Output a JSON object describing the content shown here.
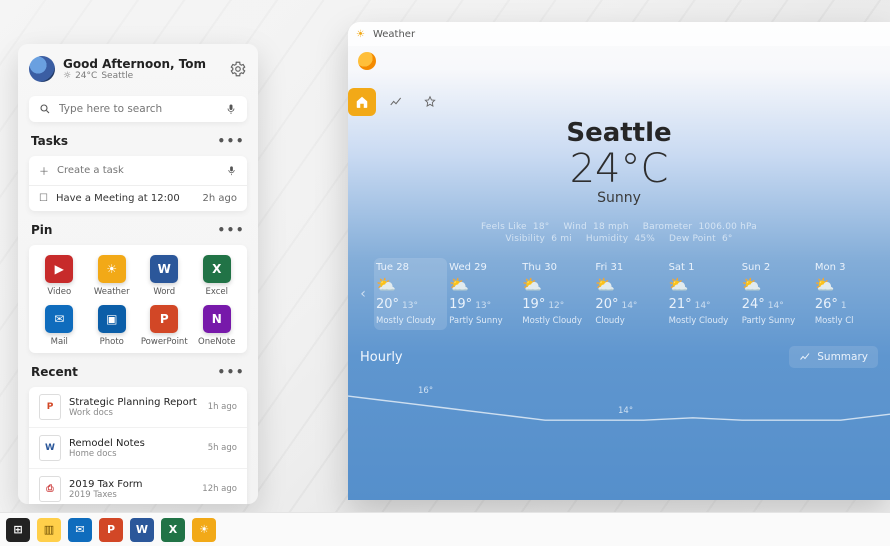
{
  "panel": {
    "greeting": "Good Afternoon, Tom",
    "sub_temp": "24°C",
    "sub_city": "Seattle",
    "search_placeholder": "Type here to search",
    "tasks_header": "Tasks",
    "task_create_placeholder": "Create a task",
    "task_item": "Have a Meeting at 12:00",
    "task_time": "2h ago",
    "pin_header": "Pin",
    "pins": [
      {
        "label": "Video",
        "bg": "#c72b2b",
        "letter": "▶"
      },
      {
        "label": "Weather",
        "bg": "#f2a917",
        "letter": "☀"
      },
      {
        "label": "Word",
        "bg": "#2b579a",
        "letter": "W"
      },
      {
        "label": "Excel",
        "bg": "#217346",
        "letter": "X"
      },
      {
        "label": "Mail",
        "bg": "#0f6cbd",
        "letter": "✉"
      },
      {
        "label": "Photo",
        "bg": "#0b5ea8",
        "letter": "▣"
      },
      {
        "label": "PowerPoint",
        "bg": "#d24726",
        "letter": "P"
      },
      {
        "label": "OneNote",
        "bg": "#7719aa",
        "letter": "N"
      }
    ],
    "recent_header": "Recent",
    "docs": [
      {
        "title": "Strategic Planning Report",
        "sub": "Work docs",
        "time": "1h ago",
        "badge": "P",
        "color": "#d24726"
      },
      {
        "title": "Remodel Notes",
        "sub": "Home docs",
        "time": "5h ago",
        "badge": "W",
        "color": "#2b579a"
      },
      {
        "title": "2019 Tax Form",
        "sub": "2019 Taxes",
        "time": "12h ago",
        "badge": "⎙",
        "color": "#cc3b3b"
      }
    ]
  },
  "weather": {
    "app_title": "Weather",
    "city": "Seattle",
    "temp": "24°C",
    "condition": "Sunny",
    "stats": {
      "feels_label": "Feels Like",
      "feels": "18°",
      "wind_label": "Wind",
      "wind": "18 mph",
      "baro_label": "Barometer",
      "baro": "1006.00 hPa",
      "vis_label": "Visibility",
      "vis": "6 mi",
      "hum_label": "Humidity",
      "hum": "45%",
      "dew_label": "Dew Point",
      "dew": "6°"
    },
    "forecast": [
      {
        "day": "Tue 28",
        "hi": "20°",
        "lo": "13°",
        "cond": "Mostly Cloudy"
      },
      {
        "day": "Wed 29",
        "hi": "19°",
        "lo": "13°",
        "cond": "Partly Sunny"
      },
      {
        "day": "Thu 30",
        "hi": "19°",
        "lo": "12°",
        "cond": "Mostly Cloudy"
      },
      {
        "day": "Fri 31",
        "hi": "20°",
        "lo": "14°",
        "cond": "Cloudy"
      },
      {
        "day": "Sat 1",
        "hi": "21°",
        "lo": "14°",
        "cond": "Mostly Cloudy"
      },
      {
        "day": "Sun 2",
        "hi": "24°",
        "lo": "14°",
        "cond": "Partly Sunny"
      },
      {
        "day": "Mon 3",
        "hi": "26°",
        "lo": "1",
        "cond": "Mostly Cl"
      }
    ],
    "hourly_label": "Hourly",
    "summary_label": "Summary",
    "chart_marks": {
      "m1": "16°",
      "m2": "14°"
    }
  },
  "chart_data": {
    "type": "line",
    "title": "Hourly",
    "ylabel": "°",
    "x": [
      0,
      1,
      2,
      3,
      4,
      5,
      6,
      7,
      8,
      9,
      10,
      11
    ],
    "values": [
      16,
      15.5,
      15,
      14.5,
      14,
      14,
      14,
      14.2,
      14,
      14,
      14,
      14.5
    ],
    "ylim": [
      12,
      18
    ]
  },
  "taskbar": [
    {
      "name": "start",
      "bg": "#222",
      "fg": "#fff",
      "glyph": "⊞"
    },
    {
      "name": "files",
      "bg": "#ffcf4a",
      "fg": "#6a4a00",
      "glyph": "▥"
    },
    {
      "name": "mail",
      "bg": "#0f6cbd",
      "fg": "#fff",
      "glyph": "✉"
    },
    {
      "name": "powerpoint",
      "bg": "#d24726",
      "fg": "#fff",
      "glyph": "P"
    },
    {
      "name": "word",
      "bg": "#2b579a",
      "fg": "#fff",
      "glyph": "W"
    },
    {
      "name": "excel",
      "bg": "#217346",
      "fg": "#fff",
      "glyph": "X"
    },
    {
      "name": "weather",
      "bg": "#f2a917",
      "fg": "#fff",
      "glyph": "☀"
    }
  ]
}
